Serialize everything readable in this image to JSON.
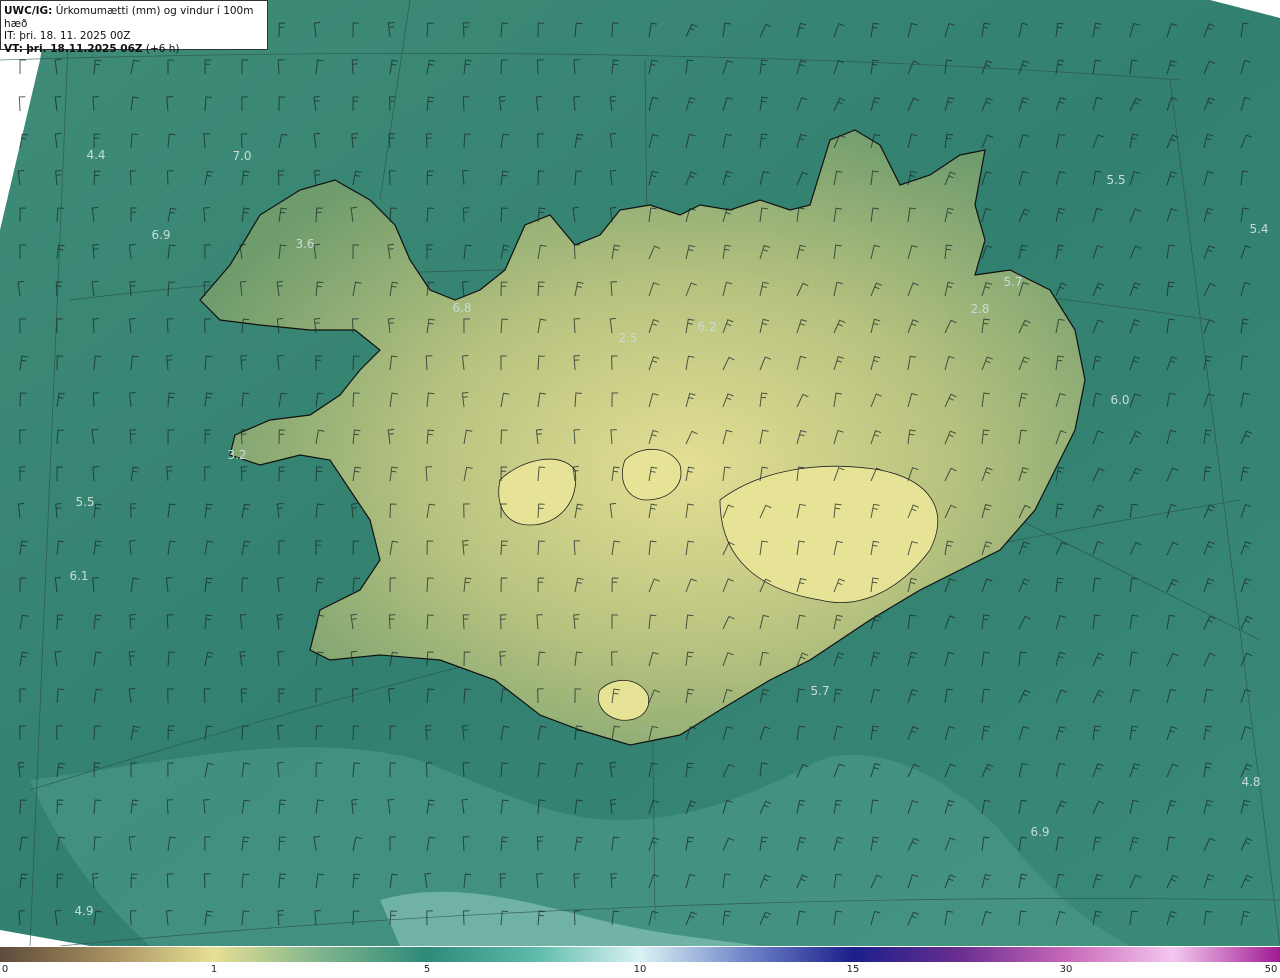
{
  "header": {
    "product": "UWC/IG:",
    "description": "Úrkomumætti (mm) og vindur í 100m hæð",
    "init_time": "IT: þri. 18. 11. 2025 00Z",
    "valid_prefix": "VT:",
    "valid_time": "þri. 18.11.2025 06Z",
    "lead": "(+6 h)"
  },
  "map_labels": [
    "4.4",
    "7.0",
    "6.9",
    "3.6",
    "6.8",
    "2.5",
    "6.2",
    "5.7",
    "2.8",
    "5.5",
    "5.4",
    "6.0",
    "3.2",
    "5.5",
    "6.1",
    "5.7",
    "4.8",
    "6.9",
    "4.9"
  ],
  "colorbar": {
    "ticks": [
      "0",
      "1",
      "5",
      "10",
      "15",
      "30",
      "50"
    ],
    "colors": [
      "#5e4b3b",
      "#a58e5f",
      "#e7e094",
      "#7fb58c",
      "#2e8a79",
      "#5cb9a8",
      "#d9f3f4",
      "#6f84c8",
      "#1b1f8a",
      "#6a2e8f",
      "#c868b8",
      "#f4c7ef",
      "#9f1a92"
    ]
  },
  "colors": {
    "sea": "#3d8878",
    "land_low": "#7aa36e",
    "land_high": "#e0dc90",
    "coast": "#111111"
  }
}
